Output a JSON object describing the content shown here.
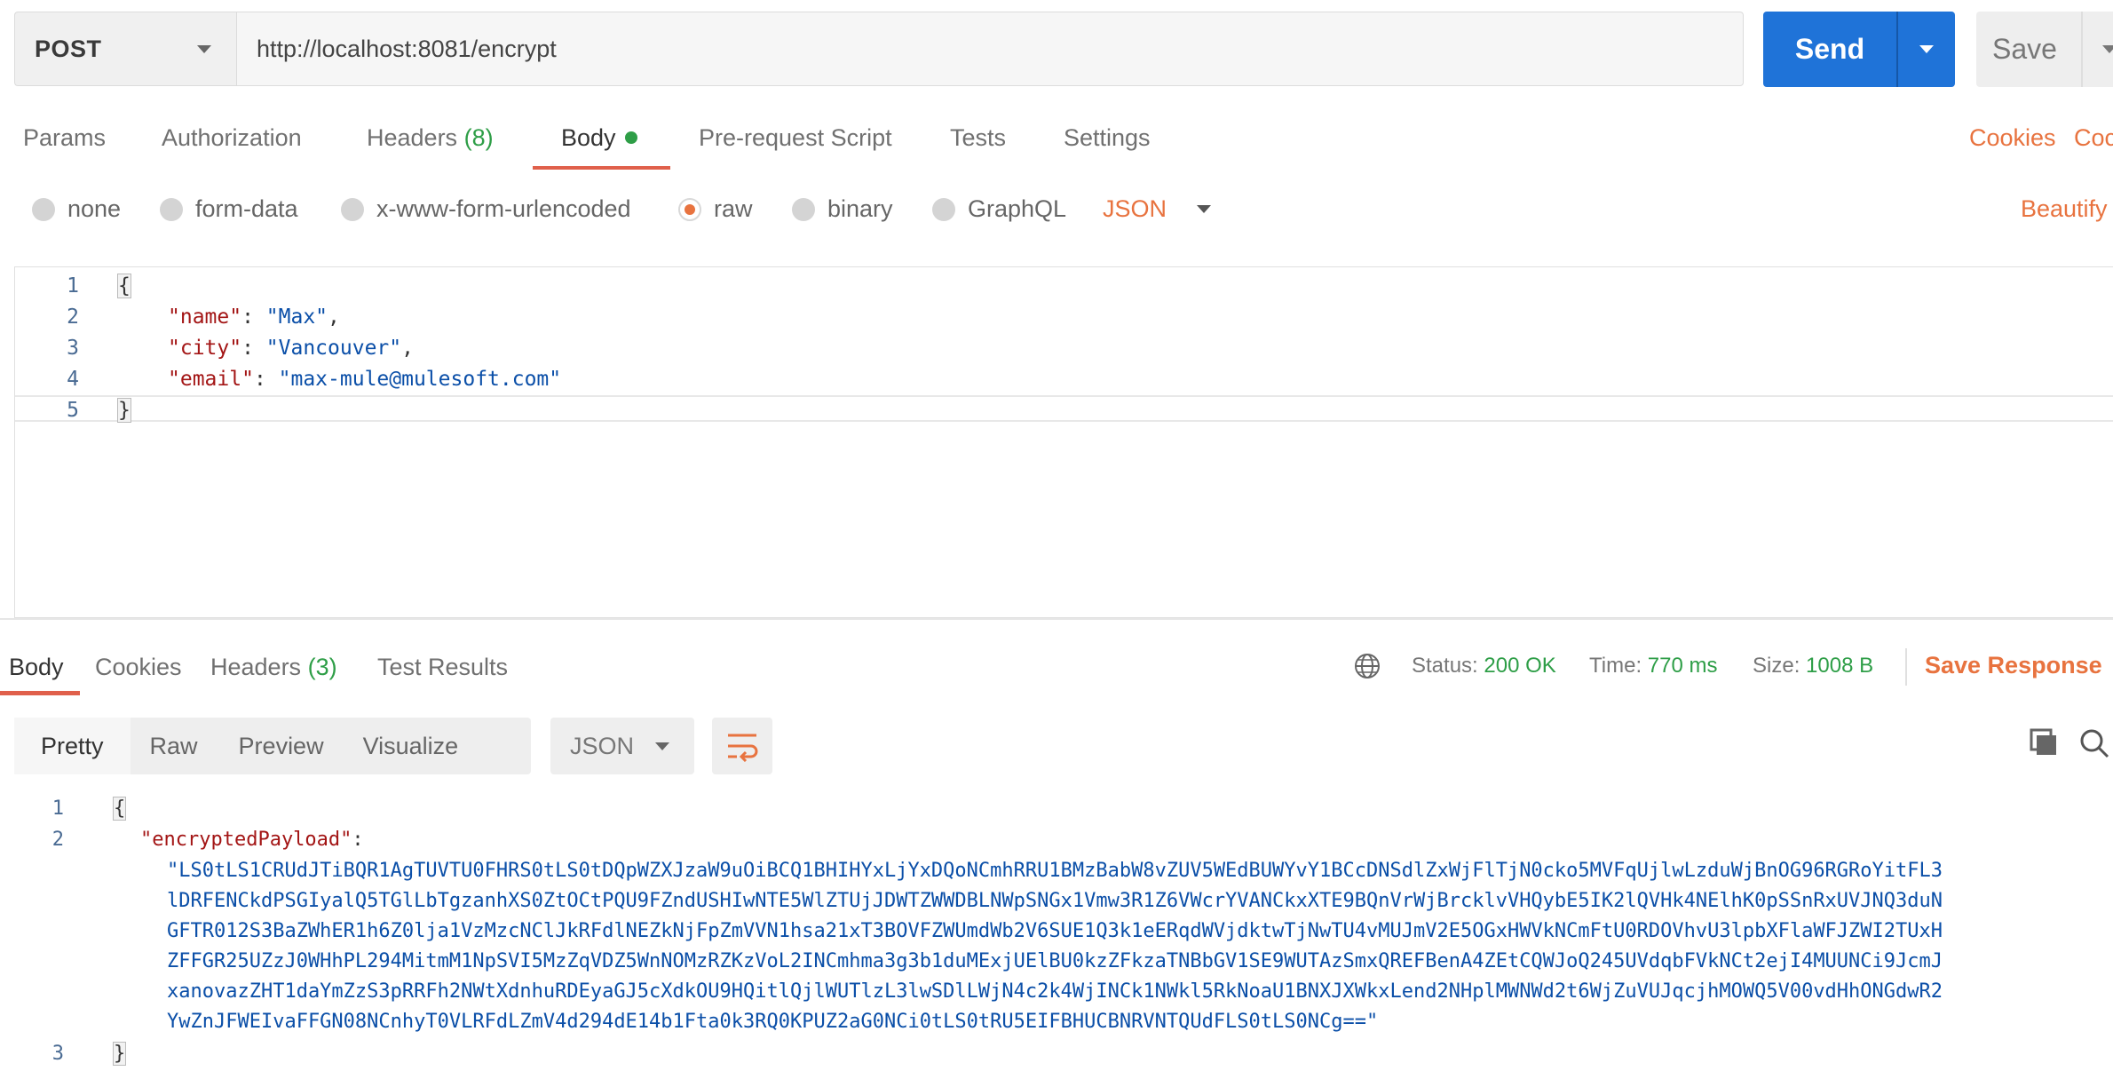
{
  "request": {
    "method": "POST",
    "url": "http://localhost:8081/encrypt",
    "send_label": "Send",
    "save_label": "Save"
  },
  "tabs": {
    "params": "Params",
    "authorization": "Authorization",
    "headers": "Headers",
    "headers_count": "(8)",
    "body": "Body",
    "prerequest": "Pre-request Script",
    "tests": "Tests",
    "settings": "Settings",
    "cookies": "Cookies",
    "code": "Coc"
  },
  "body_types": {
    "none": "none",
    "form_data": "form-data",
    "urlencoded": "x-www-form-urlencoded",
    "raw": "raw",
    "binary": "binary",
    "graphql": "GraphQL",
    "json": "JSON",
    "beautify": "Beautify"
  },
  "request_body": {
    "line_numbers": [
      "1",
      "2",
      "3",
      "4",
      "5"
    ],
    "open_brace": "{",
    "close_brace": "}",
    "fields": [
      {
        "key": "\"name\"",
        "value": "\"Max\"",
        "sep": ","
      },
      {
        "key": "\"city\"",
        "value": "\"Vancouver\"",
        "sep": ","
      },
      {
        "key": "\"email\"",
        "value": "\"max-mule@mulesoft.com\"",
        "sep": ""
      }
    ]
  },
  "response": {
    "tabs": {
      "body": "Body",
      "cookies": "Cookies",
      "headers": "Headers",
      "headers_count": "(3)",
      "test_results": "Test Results"
    },
    "status_label": "Status:",
    "status_value": "200 OK",
    "time_label": "Time:",
    "time_value": "770 ms",
    "size_label": "Size:",
    "size_value": "1008 B",
    "save_response": "Save Response",
    "views": {
      "pretty": "Pretty",
      "raw": "Raw",
      "preview": "Preview",
      "visualize": "Visualize",
      "format": "JSON"
    },
    "line_numbers": [
      "1",
      "2",
      "3"
    ],
    "open_brace": "{",
    "close_brace": "}",
    "key": "\"encryptedPayload\"",
    "colon": ":",
    "payload_lines": [
      "\"LS0tLS1CRUdJTiBQR1AgTUVTU0FHRS0tLS0tDQpWZXJzaW9uOiBCQ1BHIHYxLjYxDQoNCmhRRU1BMzBabW8vZUV5WEdBUWYvY1BCcDNSdlZxWjFlTjN0cko5MVFqUjlwLzduWjBnOG96RGRoYitFL3",
      "lDRFENCkdPSGIyalQ5TGlLbTgzanhXS0ZtOCtPQU9FZndUSHIwNTE5WlZTUjJDWTZWWDBLNWpSNGx1Vmw3R1Z6VWcrYVANCkxXTE9BQnVrWjBrcklvVHQybE5IK2lQVHk4NElhK0pSSnRxUVJNQ3duN",
      "GFTR012S3BaZWhER1h6Z0lja1VzMzcNClJkRFdlNEZkNjFpZmVVN1hsa21xT3BOVFZWUmdWb2V6SUE1Q3k1eERqdWVjdktwTjNwTU4vMUJmV2E5OGxHWVkNCmFtU0RDOVhvU3lpbXFlaWFJZWI2TUxH",
      "ZFFGR25UZzJ0WHhPL294MitmM1NpSVI5MzZqVDZ5WnNOMzRZKzVoL2INCmhma3g3b1duMExjUElBU0kzZFkzaTNBbGV1SE9WUTAzSmxQREFBenA4ZEtCQWJoQ245UVdqbFVkNCt2ejI4MUUNCi9JcmJ",
      "xanovazZHT1daYmZzS3pRRFh2NWtXdnhuRDEyaGJ5cXdkOU9HQitlQjlWUTlzL3lwSDlLWjN4c2k4WjINCk1NWkl5RkNoaU1BNXJXWkxLend2NHplMWNWd2t6WjZuVUJqcjhMOWQ5V00vdHhONGdwR2",
      "YwZnJFWEIvaFFGN08NCnhyT0VLRFdLZmV4d294dE14b1Fta0k3RQ0KPUZ2aG0NCi0tLS0tRU5EIFBHUCBNRVNTQUdFLS0tLS0NCg==\""
    ]
  }
}
